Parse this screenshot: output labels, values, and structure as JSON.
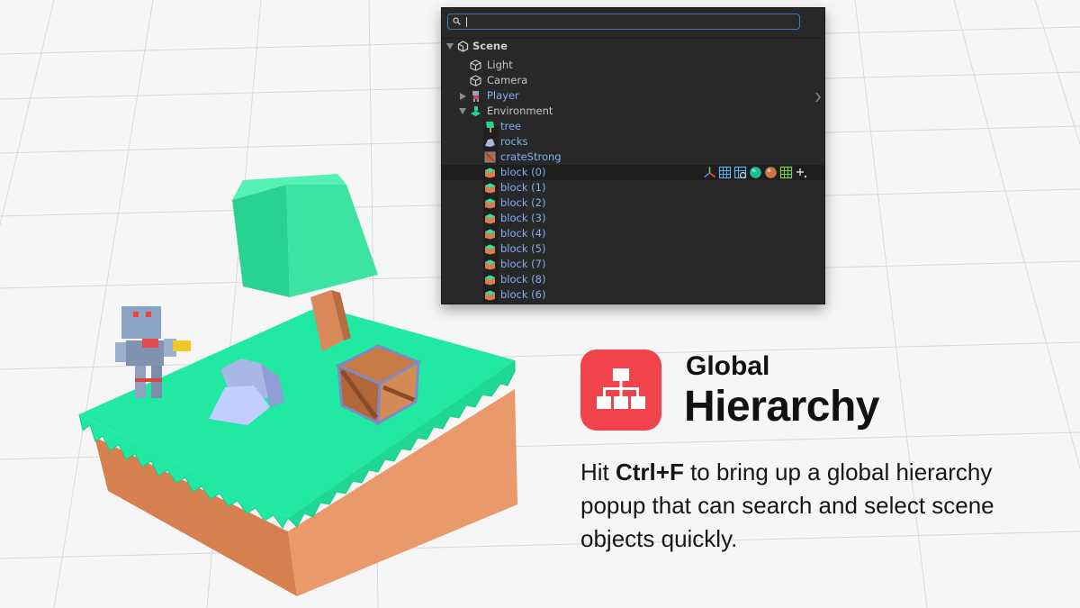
{
  "search": {
    "placeholder": "",
    "value": ""
  },
  "hierarchy": {
    "scene": "Scene",
    "items": [
      {
        "label": "Light"
      },
      {
        "label": "Camera"
      },
      {
        "label": "Player"
      },
      {
        "label": "Environment"
      },
      {
        "label": "tree"
      },
      {
        "label": "rocks"
      },
      {
        "label": "crateStrong"
      },
      {
        "label": "block (0)"
      },
      {
        "label": "block (1)"
      },
      {
        "label": "block (2)"
      },
      {
        "label": "block (3)"
      },
      {
        "label": "block (4)"
      },
      {
        "label": "block (5)"
      },
      {
        "label": "block (7)"
      },
      {
        "label": "block (8)"
      },
      {
        "label": "block (6)"
      }
    ],
    "selected_item": "block (0)",
    "component_icons": [
      "transform-gizmo-icon",
      "grid-icon",
      "grid-gear-icon",
      "teal-sphere-icon",
      "brown-sphere-icon",
      "green-grid-icon",
      "add-component-icon"
    ]
  },
  "promo": {
    "title_line1": "Global",
    "title_line2": "Hierarchy",
    "desc_pre": "Hit ",
    "desc_key": "Ctrl+F",
    "desc_post": " to bring up a global hierarchy popup that can search and select scene objects quickly."
  },
  "colors": {
    "accent": "#f2434c",
    "panel_bg": "#282828",
    "prefab_label": "#7fb1f4",
    "grass": "#1de9a0",
    "dirt": "#e08a5b"
  }
}
